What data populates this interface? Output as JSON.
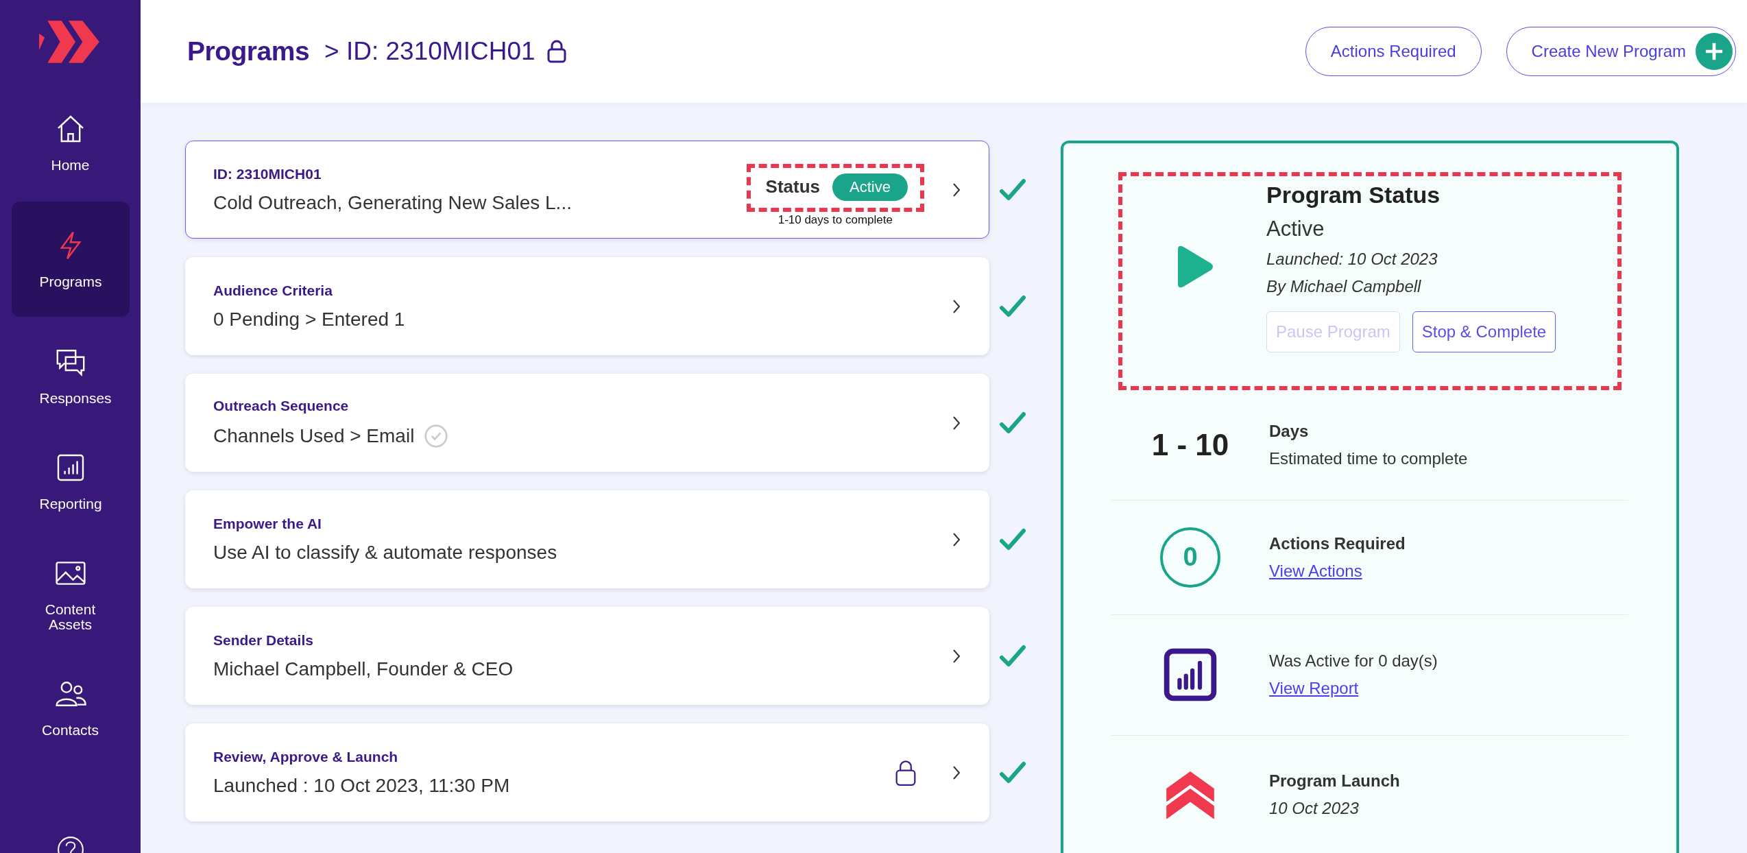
{
  "header": {
    "title": "Programs",
    "breadcrumb": "> ID: 2310MICH01",
    "buttons": [
      {
        "label": "Actions Required",
        "kind": "outline"
      },
      {
        "label": "Create New Program",
        "kind": "create"
      }
    ]
  },
  "sidebar": {
    "items": [
      {
        "label": "Home",
        "selected": false
      },
      {
        "label": "Programs",
        "selected": true
      },
      {
        "label": "Responses",
        "selected": false
      },
      {
        "label": "Reporting",
        "selected": false
      },
      {
        "label": "Content Assets",
        "selected": false
      },
      {
        "label": "Contacts",
        "selected": false
      }
    ]
  },
  "steps": [
    {
      "kind": "status",
      "label": "ID: 2310MICH01",
      "value": "Cold Outreach, Generating New Sales L...",
      "selected": true,
      "complete": true,
      "status_label": "Status",
      "status_badge": "Active",
      "note": "1-10 days to complete"
    },
    {
      "kind": "plain",
      "label": "Audience Criteria",
      "value": "0 Pending > Entered 1",
      "selected": false,
      "complete": true
    },
    {
      "kind": "verified",
      "label": "Outreach Sequence",
      "value": "Channels Used > Email",
      "selected": false,
      "complete": true
    },
    {
      "kind": "plain",
      "label": "Empower the AI",
      "value": "Use AI to classify & automate responses",
      "selected": false,
      "complete": true
    },
    {
      "kind": "plain",
      "label": "Sender Details",
      "value": "Michael Campbell, Founder & CEO",
      "selected": false,
      "complete": true
    },
    {
      "kind": "locked",
      "label": "Review, Approve & Launch",
      "value": "Launched : 10 Oct 2023, 11:30 PM",
      "selected": false,
      "complete": true
    }
  ],
  "panel": {
    "sections": [
      {
        "kind": "status",
        "title": "Program Status",
        "state": "Active",
        "launched": "Launched: 10 Oct 2023",
        "by": "By Michael Campbell",
        "buttons": [
          {
            "label": "Pause Program",
            "disabled": true
          },
          {
            "label": "Stop & Complete",
            "disabled": false
          }
        ]
      },
      {
        "kind": "days",
        "figure": "1 - 10",
        "title": "Days",
        "text": "Estimated time to complete"
      },
      {
        "kind": "actions",
        "figure": "0",
        "title": "Actions Required",
        "link": "View Actions"
      },
      {
        "kind": "report",
        "text": "Was Active for 0 day(s)",
        "link": "View Report"
      },
      {
        "kind": "launch",
        "title": "Program Launch",
        "date": "10 Oct 2023"
      }
    ]
  }
}
